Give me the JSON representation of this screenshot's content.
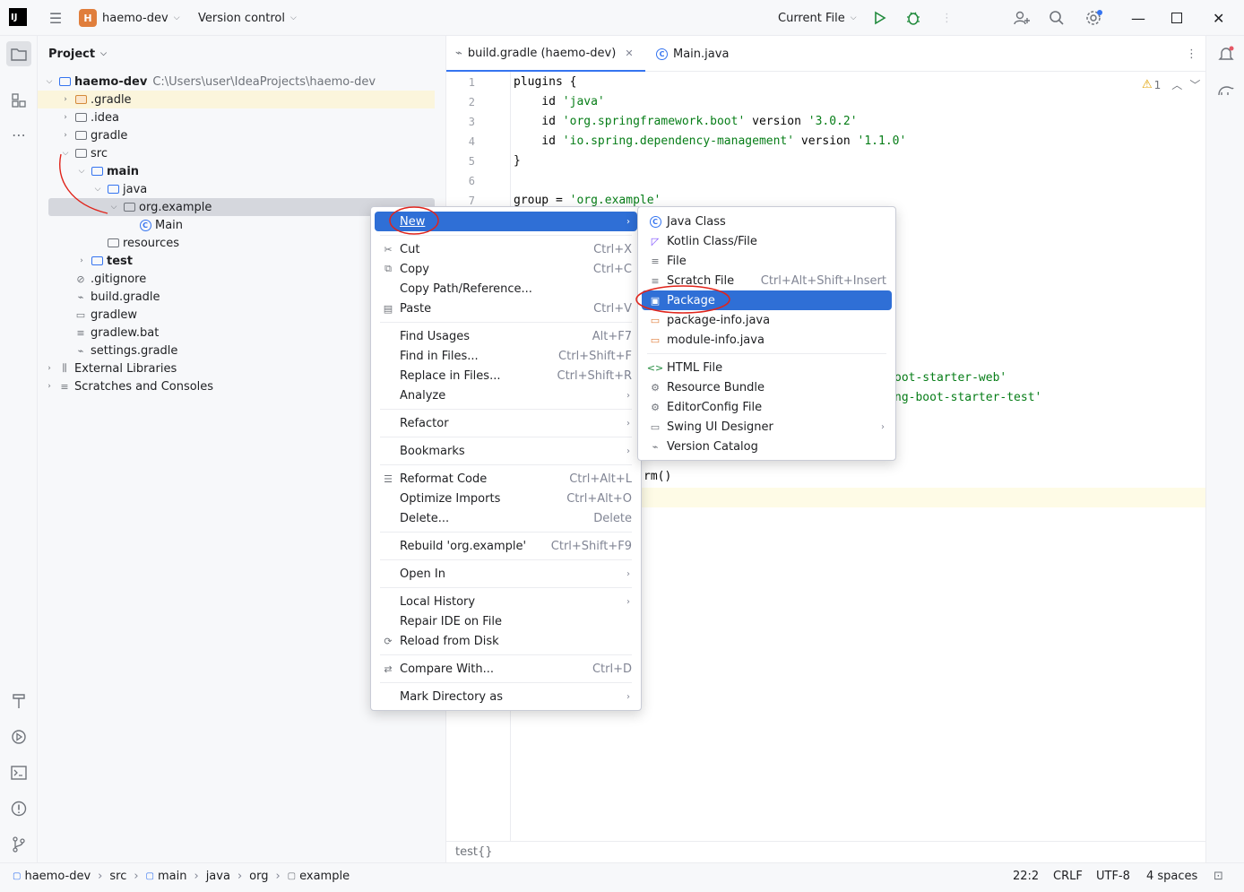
{
  "titlebar": {
    "logo": "IJ",
    "project_badge": "H",
    "project_name": "haemo-dev",
    "vcs_label": "Version control",
    "run_config": "Current File"
  },
  "project_panel": {
    "title": "Project",
    "root": {
      "name": "haemo-dev",
      "path": "C:\\Users\\user\\IdeaProjects\\haemo-dev"
    },
    "items": [
      {
        "label": ".gradle"
      },
      {
        "label": ".idea"
      },
      {
        "label": "gradle"
      },
      {
        "label": "src"
      },
      {
        "label": "main"
      },
      {
        "label": "java"
      },
      {
        "label": "org.example"
      },
      {
        "label": "Main"
      },
      {
        "label": "resources"
      },
      {
        "label": "test"
      },
      {
        "label": ".gitignore"
      },
      {
        "label": "build.gradle"
      },
      {
        "label": "gradlew"
      },
      {
        "label": "gradlew.bat"
      },
      {
        "label": "settings.gradle"
      },
      {
        "label": "External Libraries"
      },
      {
        "label": "Scratches and Consoles"
      }
    ]
  },
  "editor": {
    "tabs": [
      {
        "label": "build.gradle (haemo-dev)"
      },
      {
        "label": "Main.java"
      }
    ],
    "warning_count": "1",
    "lines": [
      {
        "n": "1",
        "code": "plugins {"
      },
      {
        "n": "2",
        "code": "    id ",
        "str": "'java'"
      },
      {
        "n": "3",
        "code": "    id ",
        "str": "'org.springframework.boot'",
        "rest": " version ",
        "str2": "'3.0.2'"
      },
      {
        "n": "4",
        "code": "    id ",
        "str": "'io.spring.dependency-management'",
        "rest": " version ",
        "str2": "'1.1.0'"
      },
      {
        "n": "5",
        "code": "}"
      },
      {
        "n": "6",
        "code": ""
      },
      {
        "n": "7",
        "code": "group = ",
        "str": "'org.example'"
      }
    ],
    "partial_lines": {
      "starter_web": "oot-starter-web'",
      "starter_test": "ng-boot-starter-test'",
      "platform": "rm()"
    },
    "breadcrumb": "test{}"
  },
  "context_menu": {
    "items": [
      {
        "label": "New"
      },
      {
        "label": "Cut",
        "shortcut": "Ctrl+X"
      },
      {
        "label": "Copy",
        "shortcut": "Ctrl+C"
      },
      {
        "label": "Copy Path/Reference..."
      },
      {
        "label": "Paste",
        "shortcut": "Ctrl+V"
      },
      {
        "label": "Find Usages",
        "shortcut": "Alt+F7"
      },
      {
        "label": "Find in Files...",
        "shortcut": "Ctrl+Shift+F"
      },
      {
        "label": "Replace in Files...",
        "shortcut": "Ctrl+Shift+R"
      },
      {
        "label": "Analyze"
      },
      {
        "label": "Refactor"
      },
      {
        "label": "Bookmarks"
      },
      {
        "label": "Reformat Code",
        "shortcut": "Ctrl+Alt+L"
      },
      {
        "label": "Optimize Imports",
        "shortcut": "Ctrl+Alt+O"
      },
      {
        "label": "Delete...",
        "shortcut": "Delete"
      },
      {
        "label": "Rebuild 'org.example'",
        "shortcut": "Ctrl+Shift+F9"
      },
      {
        "label": "Open In"
      },
      {
        "label": "Local History"
      },
      {
        "label": "Repair IDE on File"
      },
      {
        "label": "Reload from Disk"
      },
      {
        "label": "Compare With...",
        "shortcut": "Ctrl+D"
      },
      {
        "label": "Mark Directory as"
      }
    ]
  },
  "submenu": {
    "items": [
      {
        "label": "Java Class"
      },
      {
        "label": "Kotlin Class/File"
      },
      {
        "label": "File"
      },
      {
        "label": "Scratch File",
        "shortcut": "Ctrl+Alt+Shift+Insert"
      },
      {
        "label": "Package"
      },
      {
        "label": "package-info.java"
      },
      {
        "label": "module-info.java"
      },
      {
        "label": "HTML File"
      },
      {
        "label": "Resource Bundle"
      },
      {
        "label": "EditorConfig File"
      },
      {
        "label": "Swing UI Designer"
      },
      {
        "label": "Version Catalog"
      }
    ]
  },
  "statusbar": {
    "crumbs": [
      "haemo-dev",
      "src",
      "main",
      "java",
      "org",
      "example"
    ],
    "position": "22:2",
    "line_sep": "CRLF",
    "encoding": "UTF-8",
    "indent": "4 spaces"
  },
  "colors": {
    "accent": "#3574f0",
    "selection": "#2f6fd6",
    "annotation": "#e0241b",
    "string": "#067d17"
  }
}
